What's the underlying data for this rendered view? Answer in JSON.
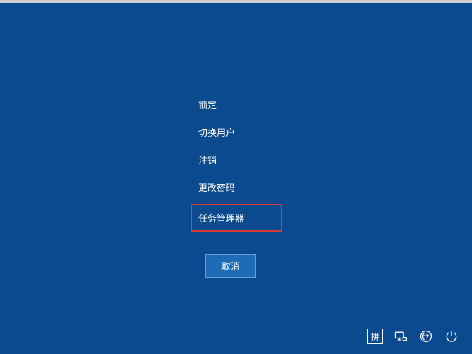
{
  "menu": {
    "items": [
      {
        "label": "锁定"
      },
      {
        "label": "切换用户"
      },
      {
        "label": "注销"
      },
      {
        "label": "更改密码"
      },
      {
        "label": "任务管理器"
      }
    ],
    "cancel_label": "取消"
  },
  "tray": {
    "ime_label": "拼"
  }
}
